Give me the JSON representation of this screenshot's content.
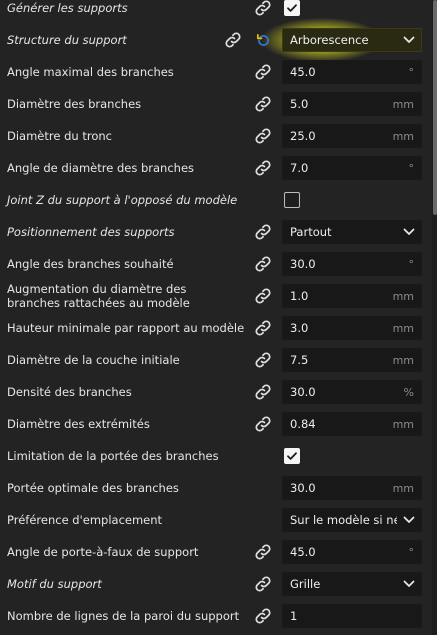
{
  "settings": [
    {
      "label": "Générer les supports",
      "italic": true,
      "link": true,
      "control": "checkbox",
      "checked": true
    },
    {
      "label": "Structure du support",
      "italic": true,
      "link": true,
      "linkLeft": true,
      "reset": true,
      "control": "select",
      "value": "Arborescence",
      "highlight": true
    },
    {
      "label": "Angle maximal des branches",
      "link": true,
      "control": "input",
      "value": "45.0",
      "unit": "°"
    },
    {
      "label": "Diamètre des branches",
      "link": true,
      "control": "input",
      "value": "5.0",
      "unit": "mm"
    },
    {
      "label": "Diamètre du tronc",
      "link": true,
      "control": "input",
      "value": "25.0",
      "unit": "mm"
    },
    {
      "label": "Angle de diamètre des branches",
      "link": true,
      "control": "input",
      "value": "7.0",
      "unit": "°"
    },
    {
      "label": "Joint Z du support à l'opposé du modèle",
      "italic": true,
      "control": "checkbox",
      "checked": false
    },
    {
      "label": "Positionnement des supports",
      "italic": true,
      "link": true,
      "control": "select",
      "value": "Partout"
    },
    {
      "label": "Angle des branches souhaité",
      "link": true,
      "control": "input",
      "value": "30.0",
      "unit": "°"
    },
    {
      "label": "Augmentation du diamètre des branches rattachées au modèle",
      "multi": true,
      "link": true,
      "control": "input",
      "value": "1.0",
      "unit": "mm"
    },
    {
      "label": "Hauteur minimale par rapport au modèle",
      "link": true,
      "control": "input",
      "value": "3.0",
      "unit": "mm"
    },
    {
      "label": "Diamètre de la couche initiale",
      "link": true,
      "control": "input",
      "value": "7.5",
      "unit": "mm"
    },
    {
      "label": "Densité des branches",
      "link": true,
      "control": "input",
      "value": "30.0",
      "unit": "%"
    },
    {
      "label": "Diamètre des extrémités",
      "link": true,
      "control": "input",
      "value": "0.84",
      "unit": "mm"
    },
    {
      "label": "Limitation de la portée des branches",
      "control": "checkbox",
      "checked": true
    },
    {
      "label": "Portée optimale des branches",
      "control": "input",
      "value": "30.0",
      "unit": "mm"
    },
    {
      "label": "Préférence d'emplacement",
      "control": "select",
      "value": "Sur le modèle si né..."
    },
    {
      "label": "Angle de porte-à-faux de support",
      "link": true,
      "control": "input",
      "value": "45.0",
      "unit": "°"
    },
    {
      "label": "Motif du support",
      "italic": true,
      "link": true,
      "control": "select",
      "value": "Grille"
    },
    {
      "label": "Nombre de lignes de la paroi du support",
      "link": true,
      "control": "input",
      "value": "1",
      "unit": ""
    }
  ],
  "icons": {
    "link": "link-icon",
    "reset": "reset-arrow-icon",
    "chevron": "chevron-down-icon",
    "check": "checkmark-icon"
  },
  "colors": {
    "background": "#232323",
    "field": "#181818",
    "highlight": "#f0f014",
    "resetArrow": "#2f7bd6"
  }
}
